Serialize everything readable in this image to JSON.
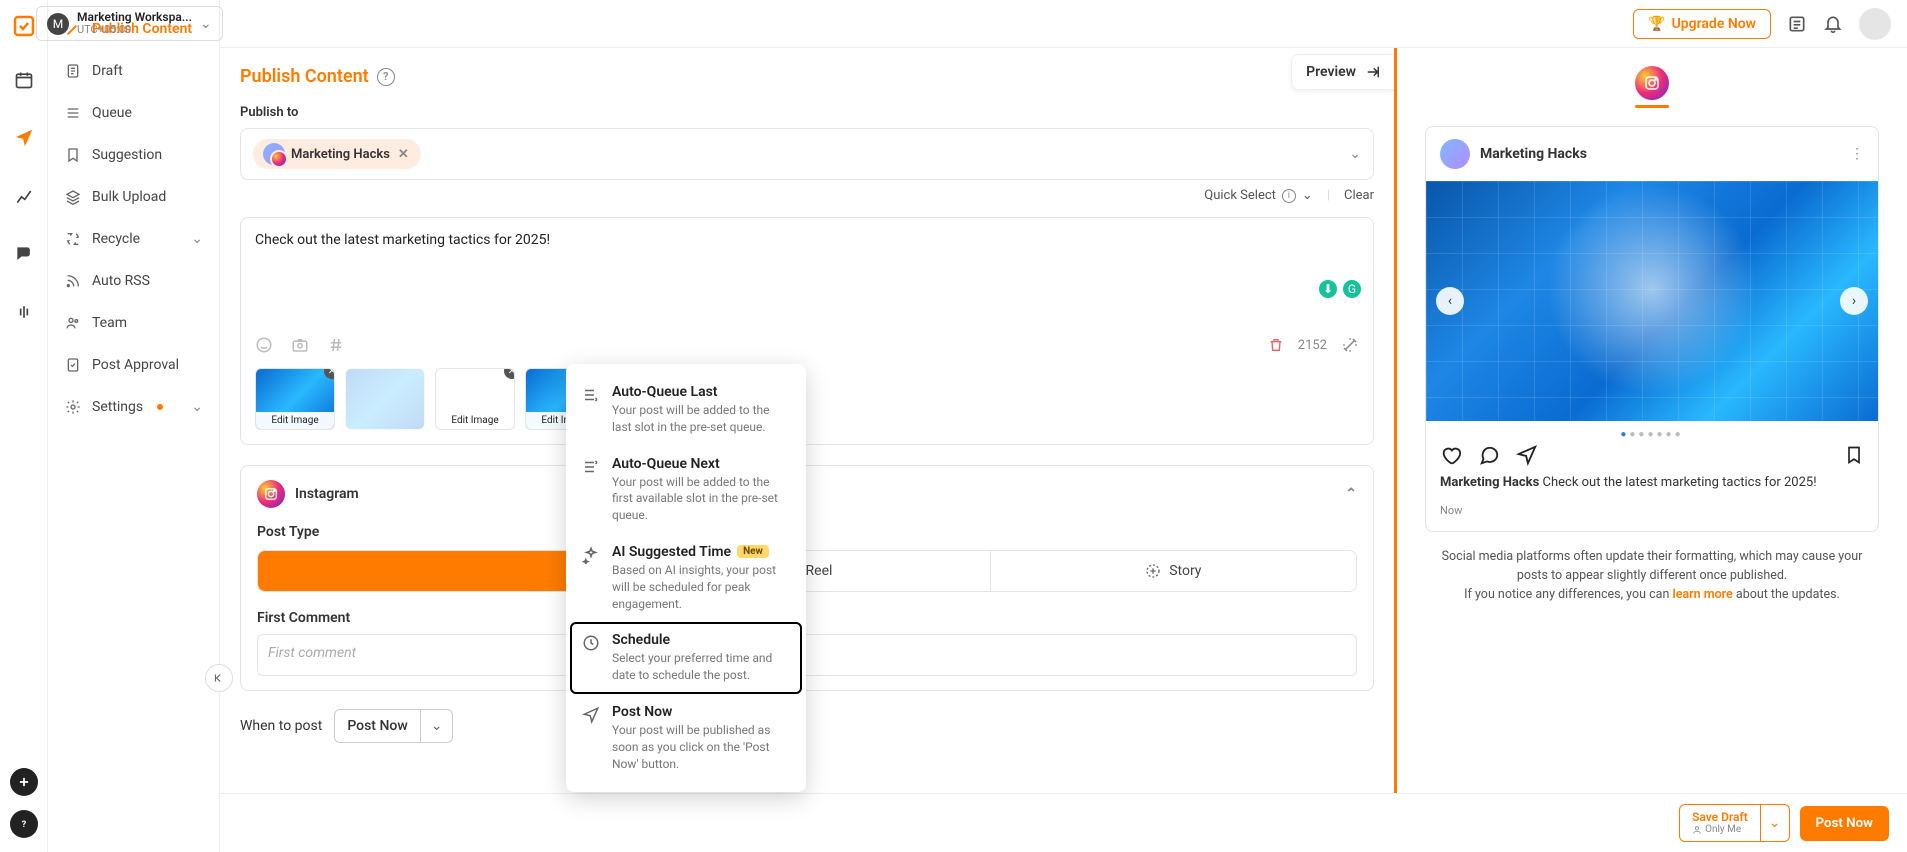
{
  "workspace": {
    "initial": "M",
    "name": "Marketing Workspa...",
    "timezone": "UTC+05:00"
  },
  "topbar": {
    "upgrade": "Upgrade Now"
  },
  "sidebar": {
    "publish_content": "Publish Content",
    "draft": "Draft",
    "queue": "Queue",
    "suggestion": "Suggestion",
    "bulk_upload": "Bulk Upload",
    "recycle": "Recycle",
    "auto_rss": "Auto RSS",
    "team": "Team",
    "post_approval": "Post Approval",
    "settings": "Settings"
  },
  "editor": {
    "title": "Publish Content",
    "preview_label": "Preview",
    "publish_to_label": "Publish to",
    "account_name": "Marketing Hacks",
    "quick_select": "Quick Select",
    "clear": "Clear",
    "compose_text": "Check out the latest marketing tactics for 2025!",
    "char_count": "2152",
    "edit_image": "Edit Image",
    "platform_name": "Instagram",
    "post_type_label": "Post Type",
    "seg_reel": "Reel",
    "seg_story": "Story",
    "first_comment_label": "First Comment",
    "first_comment_placeholder": "First comment",
    "when_to_post": "When to post",
    "when_value": "Post Now"
  },
  "when_options": {
    "auto_last": {
      "title": "Auto-Queue Last",
      "desc": "Your post will be added to the last slot in the pre-set queue."
    },
    "auto_next": {
      "title": "Auto-Queue Next",
      "desc": "Your post will be added to the first available slot in the pre-set queue."
    },
    "ai": {
      "title": "AI Suggested Time",
      "badge": "New",
      "desc": "Based on AI insights, your post will be scheduled for peak engagement."
    },
    "schedule": {
      "title": "Schedule",
      "desc": "Select your preferred time and date to schedule the post."
    },
    "post_now": {
      "title": "Post Now",
      "desc": "Your post will be published as soon as you click on the 'Post Now' button."
    }
  },
  "preview": {
    "account_name": "Marketing Hacks",
    "caption_author": "Marketing Hacks",
    "caption_text": "Check out the latest marketing tactics for 2025!",
    "time": "Now",
    "disclaimer_a": "Social media platforms often update their formatting, which may cause your posts to appear slightly different once published.",
    "disclaimer_b_pre": "If you notice any differences, you can ",
    "disclaimer_link": "learn more",
    "disclaimer_b_post": " about the updates."
  },
  "footer": {
    "save_draft": "Save Draft",
    "only_me": "Only Me",
    "post_now": "Post Now"
  }
}
